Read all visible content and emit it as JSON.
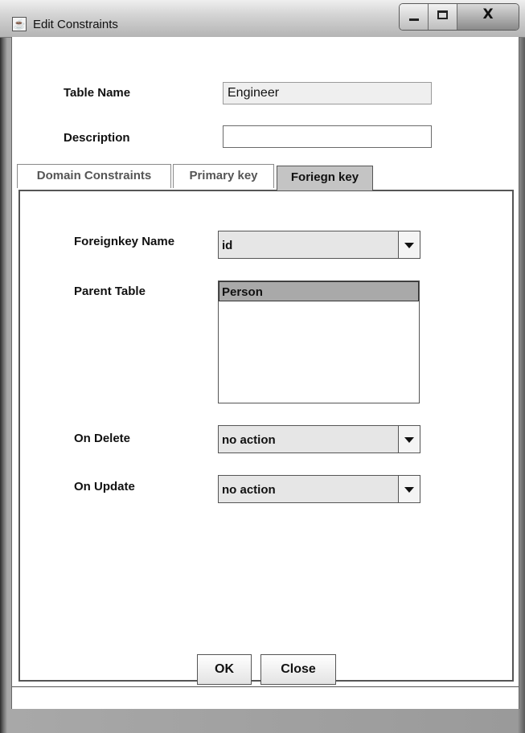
{
  "window": {
    "title": "Edit Constraints",
    "icon": "java-cup-icon"
  },
  "controls": {
    "minimize": "minimize-icon",
    "maximize": "maximize-icon",
    "close_glyph": "X"
  },
  "form": {
    "table_name_label": "Table Name",
    "table_name_value": "Engineer",
    "description_label": "Description",
    "description_value": ""
  },
  "tabs": [
    {
      "label": "Domain Constraints",
      "active": false
    },
    {
      "label": "Primary key",
      "active": false
    },
    {
      "label": "Foriegn key",
      "active": true
    }
  ],
  "foreign_key": {
    "name_label": "Foreignkey Name",
    "name_value": "id",
    "parent_table_label": "Parent Table",
    "parent_tables": [
      "Person"
    ],
    "selected_parent": "Person",
    "on_delete_label": "On Delete",
    "on_delete_value": "no action",
    "on_update_label": "On Update",
    "on_update_value": "no action"
  },
  "buttons": {
    "ok": "OK",
    "close": "Close"
  }
}
